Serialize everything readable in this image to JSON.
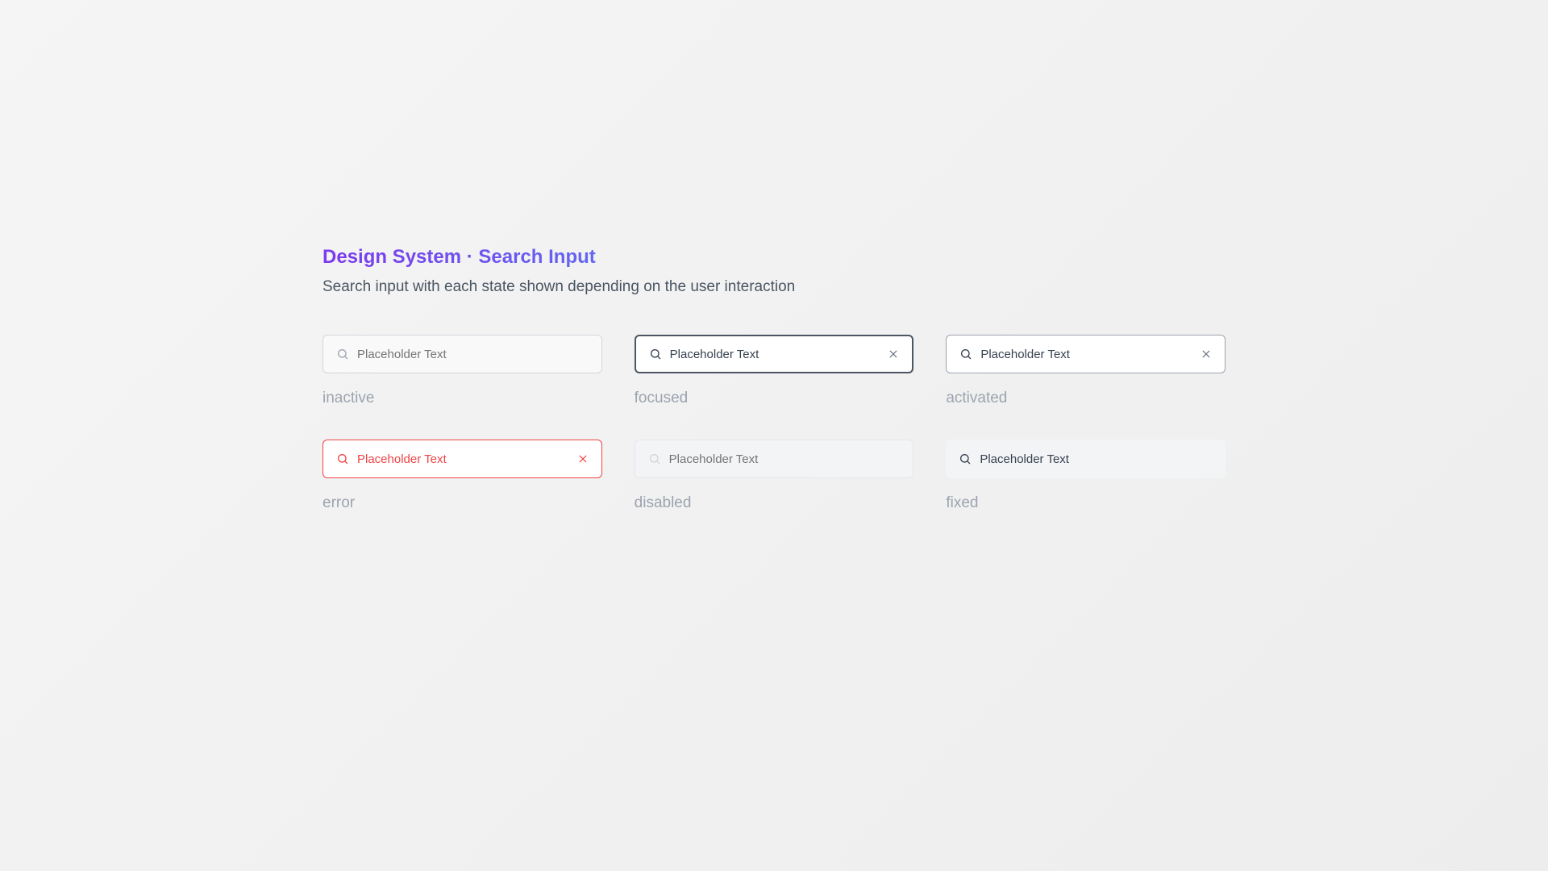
{
  "header": {
    "title": "Design System · Search Input",
    "subtitle": "Search input with each state shown depending on the user interaction"
  },
  "states": {
    "inactive": {
      "placeholder": "Placeholder Text",
      "label": "inactive"
    },
    "focused": {
      "value": "Placeholder Text",
      "label": "focused"
    },
    "activated": {
      "value": "Placeholder Text",
      "label": "activated"
    },
    "error": {
      "value": "Placeholder Text",
      "label": "error"
    },
    "disabled": {
      "placeholder": "Placeholder Text",
      "label": "disabled"
    },
    "fixed": {
      "value": "Placeholder Text",
      "label": "fixed"
    }
  },
  "colors": {
    "gradient_start": "#7c3aed",
    "gradient_end": "#059669",
    "error": "#ef4444",
    "border_focused": "#4b5563",
    "text_muted": "#9ca3af"
  }
}
